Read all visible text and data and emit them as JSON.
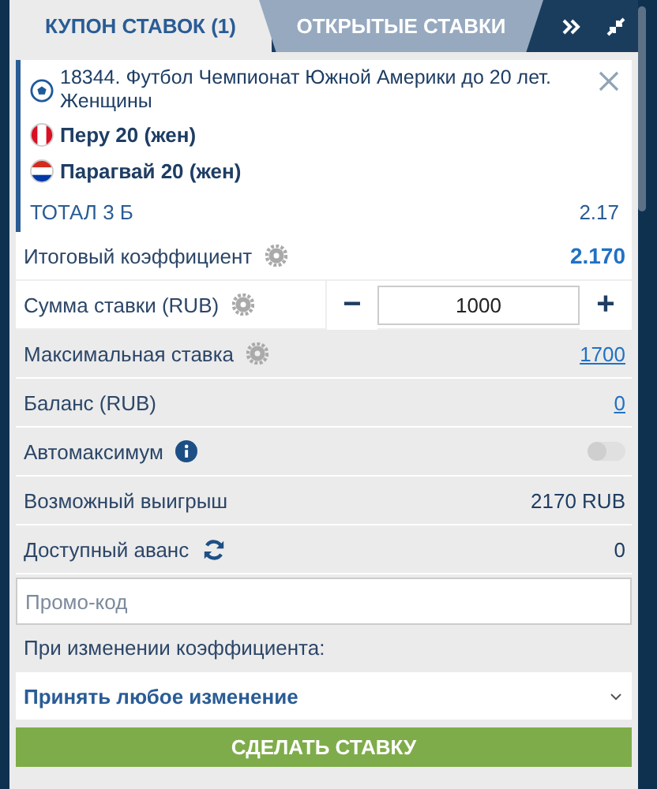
{
  "tabs": [
    {
      "label": "КУПОН СТАВОК (1)",
      "selected": true
    },
    {
      "label": "ОТКРЫТЫЕ СТАВКИ",
      "selected": false
    }
  ],
  "bet": {
    "event": "18344. Футбол Чемпионат Южной Америки до 20 лет. Женщины",
    "teams": [
      {
        "name": "Перу 20 (жен)"
      },
      {
        "name": "Парагвай 20 (жен)"
      }
    ],
    "market": "ТОТАЛ 3 Б",
    "odds": "2.17"
  },
  "total_odds": {
    "label": "Итоговый коэффициент",
    "value": "2.170"
  },
  "stake": {
    "label": "Сумма ставки (RUB)",
    "minus": "−",
    "value": "1000",
    "plus": "+"
  },
  "rows": [
    {
      "kind": "link",
      "label": "Максимальная ставка",
      "value": "1700"
    },
    {
      "kind": "link",
      "label": "Баланс (RUB)",
      "value": "0"
    },
    {
      "kind": "toggle",
      "label": "Автомаксимум",
      "on": false
    },
    {
      "kind": "text",
      "label": "Возможный выигрыш",
      "value": "2170 RUB"
    },
    {
      "kind": "text",
      "label": "Доступный аванс",
      "value": "0"
    }
  ],
  "promo": {
    "placeholder": "Промо-код"
  },
  "odds_change": {
    "label": "При изменении коэффициента:",
    "value": "Принять любое изменение"
  },
  "submit": "СДЕЛАТЬ СТАВКУ"
}
